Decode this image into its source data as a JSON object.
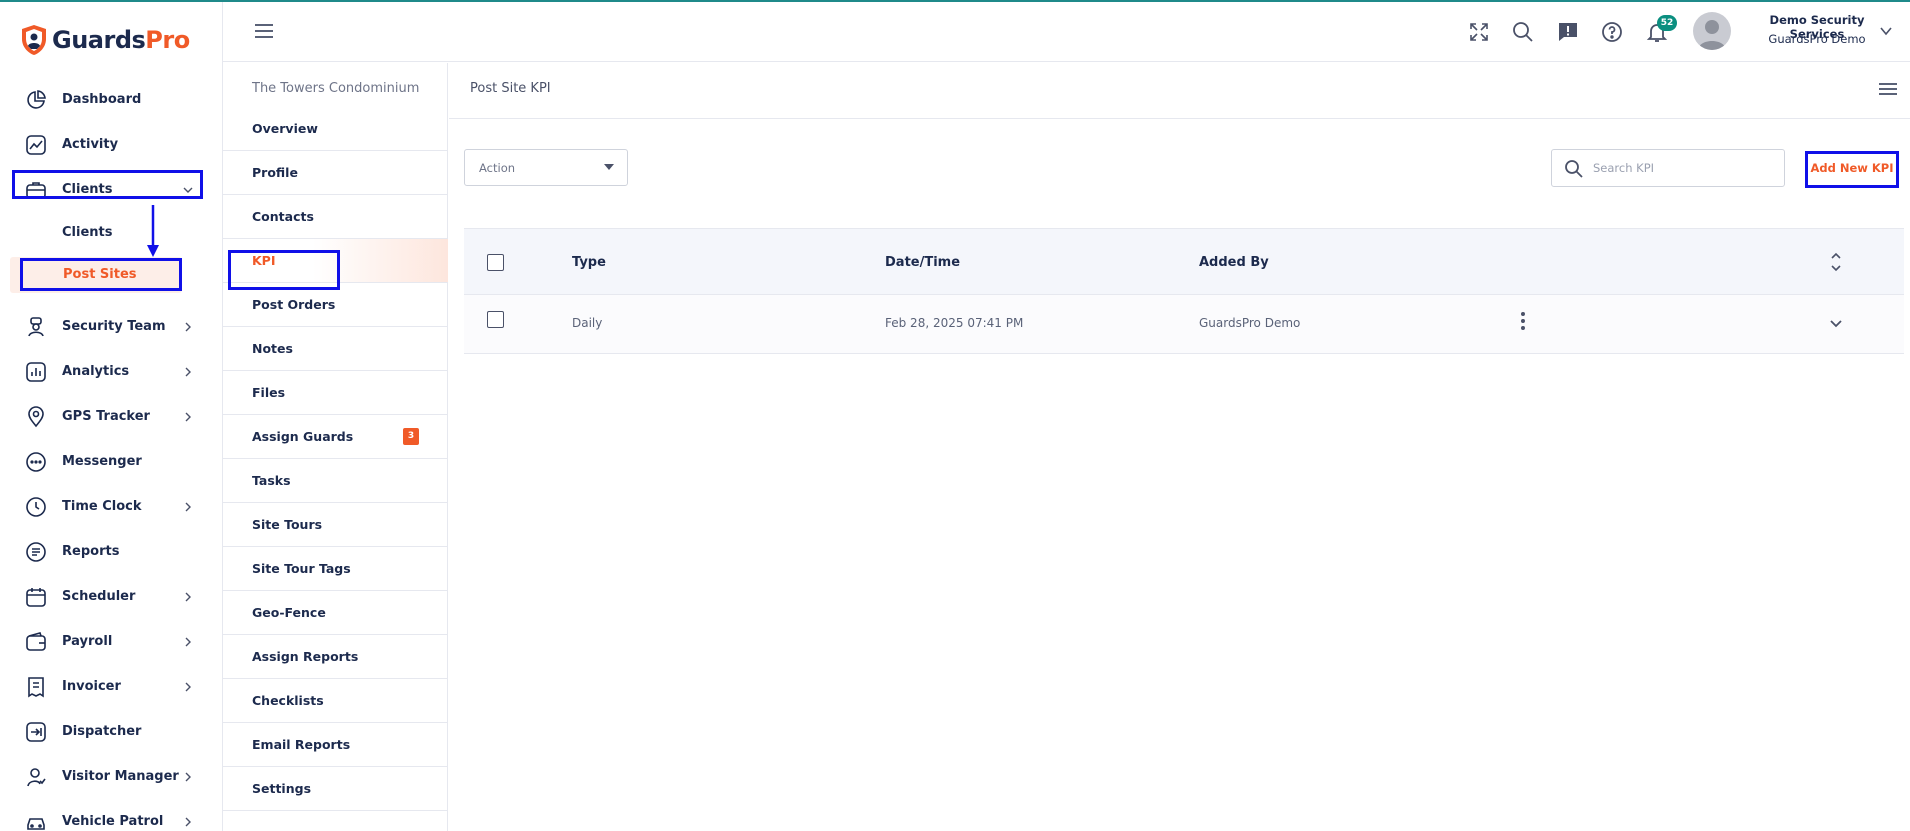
{
  "brand": {
    "name_part1": "Guards",
    "name_part2": "Pro",
    "primary": "#1c2a4d",
    "accent": "#f05a28"
  },
  "sidebar": {
    "items": [
      {
        "label": "Dashboard",
        "icon": "dashboard-icon"
      },
      {
        "label": "Activity",
        "icon": "activity-icon"
      },
      {
        "label": "Clients",
        "icon": "briefcase-icon"
      },
      {
        "label": "Security Team",
        "icon": "guard-icon"
      },
      {
        "label": "Analytics",
        "icon": "analytics-icon"
      },
      {
        "label": "GPS Tracker",
        "icon": "location-pin-icon"
      },
      {
        "label": "Messenger",
        "icon": "chat-icon"
      },
      {
        "label": "Time Clock",
        "icon": "clock-icon"
      },
      {
        "label": "Reports",
        "icon": "report-icon"
      },
      {
        "label": "Scheduler",
        "icon": "calendar-icon"
      },
      {
        "label": "Payroll",
        "icon": "wallet-icon"
      },
      {
        "label": "Invoicer",
        "icon": "invoice-icon"
      },
      {
        "label": "Dispatcher",
        "icon": "dispatch-icon"
      },
      {
        "label": "Visitor Manager",
        "icon": "visitor-icon"
      },
      {
        "label": "Vehicle Patrol",
        "icon": "car-icon"
      }
    ],
    "clients_sub": {
      "clients": "Clients",
      "post_sites": "Post Sites"
    }
  },
  "header": {
    "notification_count": "52",
    "user_name": "Demo Security Services",
    "user_org": "GuardsPro Demo"
  },
  "subnav": {
    "title": "The Towers Condominium",
    "items": [
      {
        "label": "Overview"
      },
      {
        "label": "Profile"
      },
      {
        "label": "Contacts"
      },
      {
        "label": "KPI"
      },
      {
        "label": "Post Orders"
      },
      {
        "label": "Notes"
      },
      {
        "label": "Files"
      },
      {
        "label": "Assign Guards",
        "badge": "3"
      },
      {
        "label": "Tasks"
      },
      {
        "label": "Site Tours"
      },
      {
        "label": "Site Tour Tags"
      },
      {
        "label": "Geo-Fence"
      },
      {
        "label": "Assign Reports"
      },
      {
        "label": "Checklists"
      },
      {
        "label": "Email Reports"
      },
      {
        "label": "Settings"
      }
    ]
  },
  "main": {
    "title": "Post Site KPI",
    "action_label": "Action",
    "search_placeholder": "Search KPI",
    "add_button": "Add New KPI",
    "table": {
      "headers": {
        "type": "Type",
        "datetime": "Date/Time",
        "added_by": "Added By"
      },
      "rows": [
        {
          "type": "Daily",
          "datetime": "Feb 28, 2025 07:41 PM",
          "added_by": "GuardsPro Demo"
        }
      ]
    }
  }
}
